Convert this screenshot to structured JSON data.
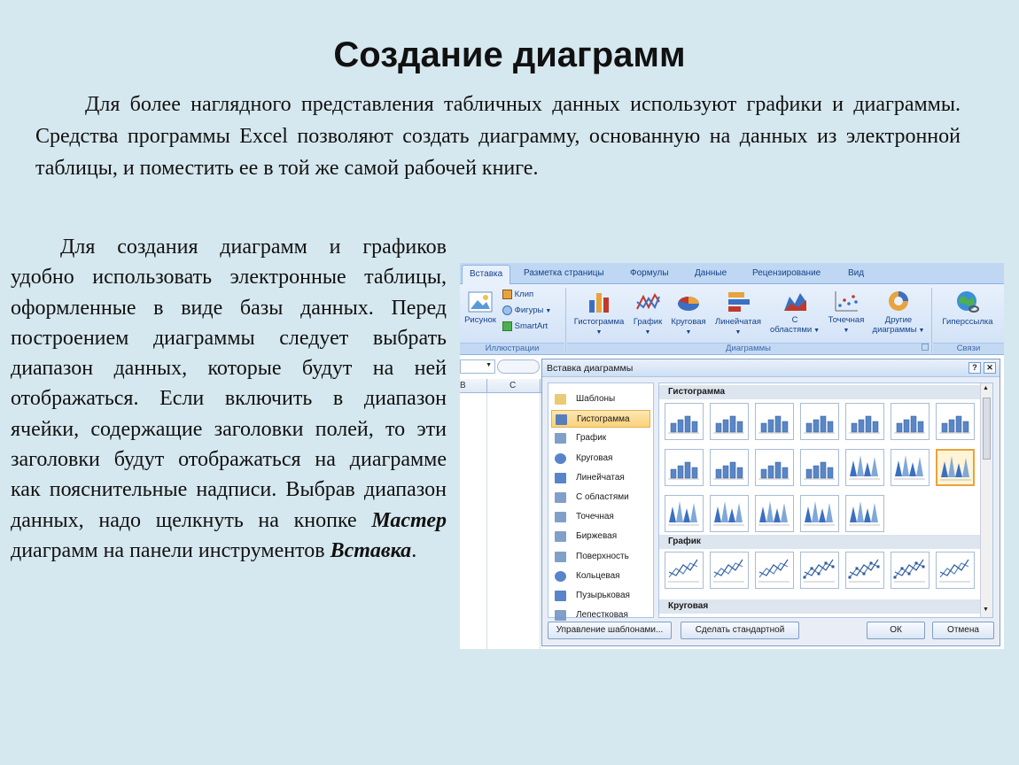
{
  "slide": {
    "title": "Создание диаграмм",
    "paragraph1": "Для более наглядного представления табличных данных используют графики и диаграммы. Средства программы Excel позволяют создать диаграмму, основанную на данных из электронной таблицы, и поместить ее в той же самой рабочей книге.",
    "p2_before": "Для создания диаграмм и графиков удобно использовать электронные таблицы, оформленные в виде базы данных. Перед построением диаграммы следует выбрать диапазон данных, которые будут на ней отображаться. Если включить в диапазон ячейки, содержащие заголовки полей, то эти заголовки будут отображаться на диаграмме как пояснительные надписи. Выбрав диапазон данных, надо щелкнуть на кнопке ",
    "p2_bold1": "Мастер",
    "p2_middle": " диаграмм на панели инструментов ",
    "p2_bold2": "Вставка",
    "p2_end": "."
  },
  "ribbon": {
    "tabs": [
      "Вставка",
      "Разметка страницы",
      "Формулы",
      "Данные",
      "Рецензирование",
      "Вид"
    ],
    "illustrations": {
      "picture": "Рисунок",
      "clip": "Клип",
      "shapes": "Фигуры",
      "smartart": "SmartArt",
      "label": "Иллюстрации"
    },
    "charts": {
      "histogram": "Гистограмма",
      "graph": "График",
      "pie": "Круговая",
      "bar": "Линейчатая",
      "area_1": "С",
      "area_2": "областями",
      "scatter": "Точечная",
      "other_1": "Другие",
      "other_2": "диаграммы",
      "label": "Диаграммы"
    },
    "links": {
      "hyperlink": "Гиперссылка",
      "label": "Связи"
    }
  },
  "sheet": {
    "col_b": "B",
    "col_c": "C"
  },
  "dialog": {
    "title": "Вставка диаграммы",
    "help": "?",
    "close": "✕",
    "categories": [
      "Шаблоны",
      "Гистограмма",
      "График",
      "Круговая",
      "Линейчатая",
      "С областями",
      "Точечная",
      "Биржевая",
      "Поверхность",
      "Кольцевая",
      "Пузырьковая",
      "Лепестковая"
    ],
    "selected_category": "Гистограмма",
    "section_histogram": "Гистограмма",
    "section_graph": "График",
    "section_pie": "Круговая",
    "btn_manage": "Управление шаблонами...",
    "btn_default": "Сделать стандартной",
    "btn_ok": "ОК",
    "btn_cancel": "Отмена"
  },
  "colors": {
    "background": "#d6e8ef",
    "ribbon": "#cfe0f6",
    "selection": "#fbd27a"
  }
}
